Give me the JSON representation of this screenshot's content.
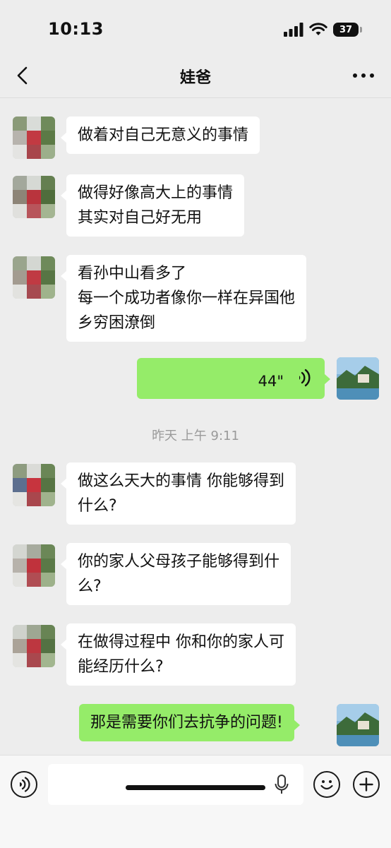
{
  "status_bar": {
    "time": "10:13",
    "battery": "37"
  },
  "nav": {
    "title": "娃爸"
  },
  "messages": [
    {
      "side": "left",
      "text": "做着对自己无意义的事情"
    },
    {
      "side": "left",
      "text": "做得好像高大上的事情\n其实对自己好无用"
    },
    {
      "side": "left",
      "text": "看孙中山看多了\n每一个成功者像你一样在异国他\n乡穷困潦倒"
    },
    {
      "side": "right",
      "type": "voice",
      "duration": "44\""
    },
    {
      "type": "timestamp",
      "text": "昨天 上午 9:11"
    },
    {
      "side": "left",
      "text": "做这么天大的事情 你能够得到\n什么?"
    },
    {
      "side": "left",
      "text": "你的家人父母孩子能够得到什\n么?"
    },
    {
      "side": "left",
      "text": "在做得过程中 你和你的家人可\n能经历什么?"
    },
    {
      "side": "right",
      "text": "那是需要你们去抗争的问题!"
    }
  ],
  "colors": {
    "background": "#ededed",
    "sent_bubble": "#95ec69",
    "received_bubble": "#ffffff"
  },
  "icons": [
    "back-chevron-icon",
    "more-dots-icon",
    "voice-wave-icon",
    "voice-input-icon",
    "microphone-icon",
    "emoji-icon",
    "add-icon"
  ]
}
